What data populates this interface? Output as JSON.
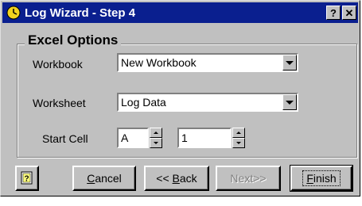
{
  "window": {
    "title": "Log Wizard - Step 4",
    "title_bar_color": "#0a1f8f",
    "help_button_label": "?",
    "close_button_label": "✕"
  },
  "group": {
    "title": "Excel Options",
    "workbook": {
      "label": "Workbook",
      "value": "New Workbook"
    },
    "worksheet": {
      "label": "Worksheet",
      "value": "Log Data"
    },
    "start_cell": {
      "label": "Start Cell",
      "column": "A",
      "row": "1"
    }
  },
  "buttons": {
    "help_icon": "help-book-icon",
    "cancel_mnemonic": "C",
    "cancel_rest": "ancel",
    "back_prefix": "<< ",
    "back_mnemonic": "B",
    "back_rest": "ack",
    "next": "Next>>",
    "finish_mnemonic": "F",
    "finish_rest": "inish"
  }
}
